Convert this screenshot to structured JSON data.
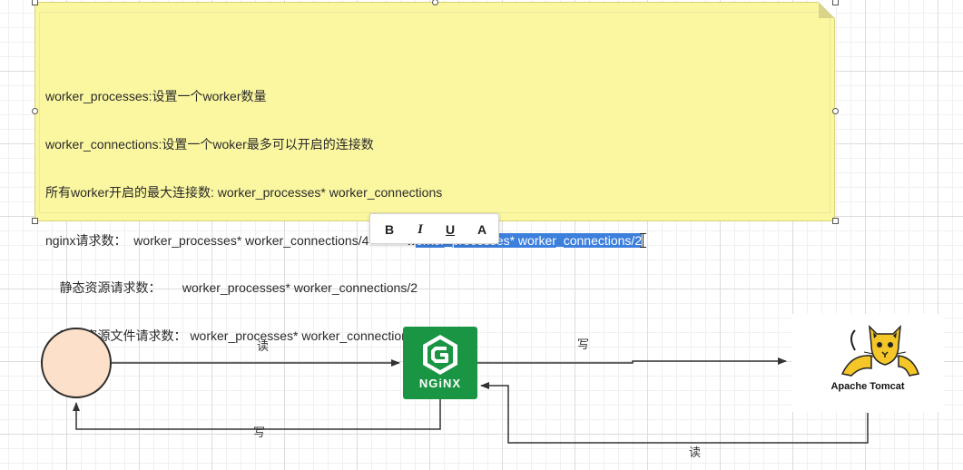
{
  "note": {
    "lines": [
      "worker_processes:设置一个worker数量",
      "worker_connections:设置一个woker最多可以开启的连接数",
      "所有worker开启的最大连接数: worker_processes* worker_connections",
      "nginx请求数：  worker_processes* worker_connections/4 --->    w",
      "    静态资源请求数：      worker_processes* worker_connections/2",
      "    动态资源文件请求数： worker_processes* worker_connections/4"
    ],
    "selected_text": "orker_processes* worker_connections/2"
  },
  "format_toolbar": {
    "bold": "B",
    "italic": "I",
    "underline": "U",
    "font_color": "A"
  },
  "diagram": {
    "nginx_label": "NGiNX",
    "tomcat_label": "Apache Tomcat",
    "edges": {
      "client_to_nginx": "读",
      "nginx_to_client": "写",
      "nginx_to_tomcat": "写",
      "tomcat_to_nginx": "读"
    },
    "colors": {
      "client_fill": "#fce0c9",
      "nginx_green": "#1a9544",
      "note_yellow": "#fbf7a0",
      "selection_blue": "#3d7fdd"
    }
  }
}
